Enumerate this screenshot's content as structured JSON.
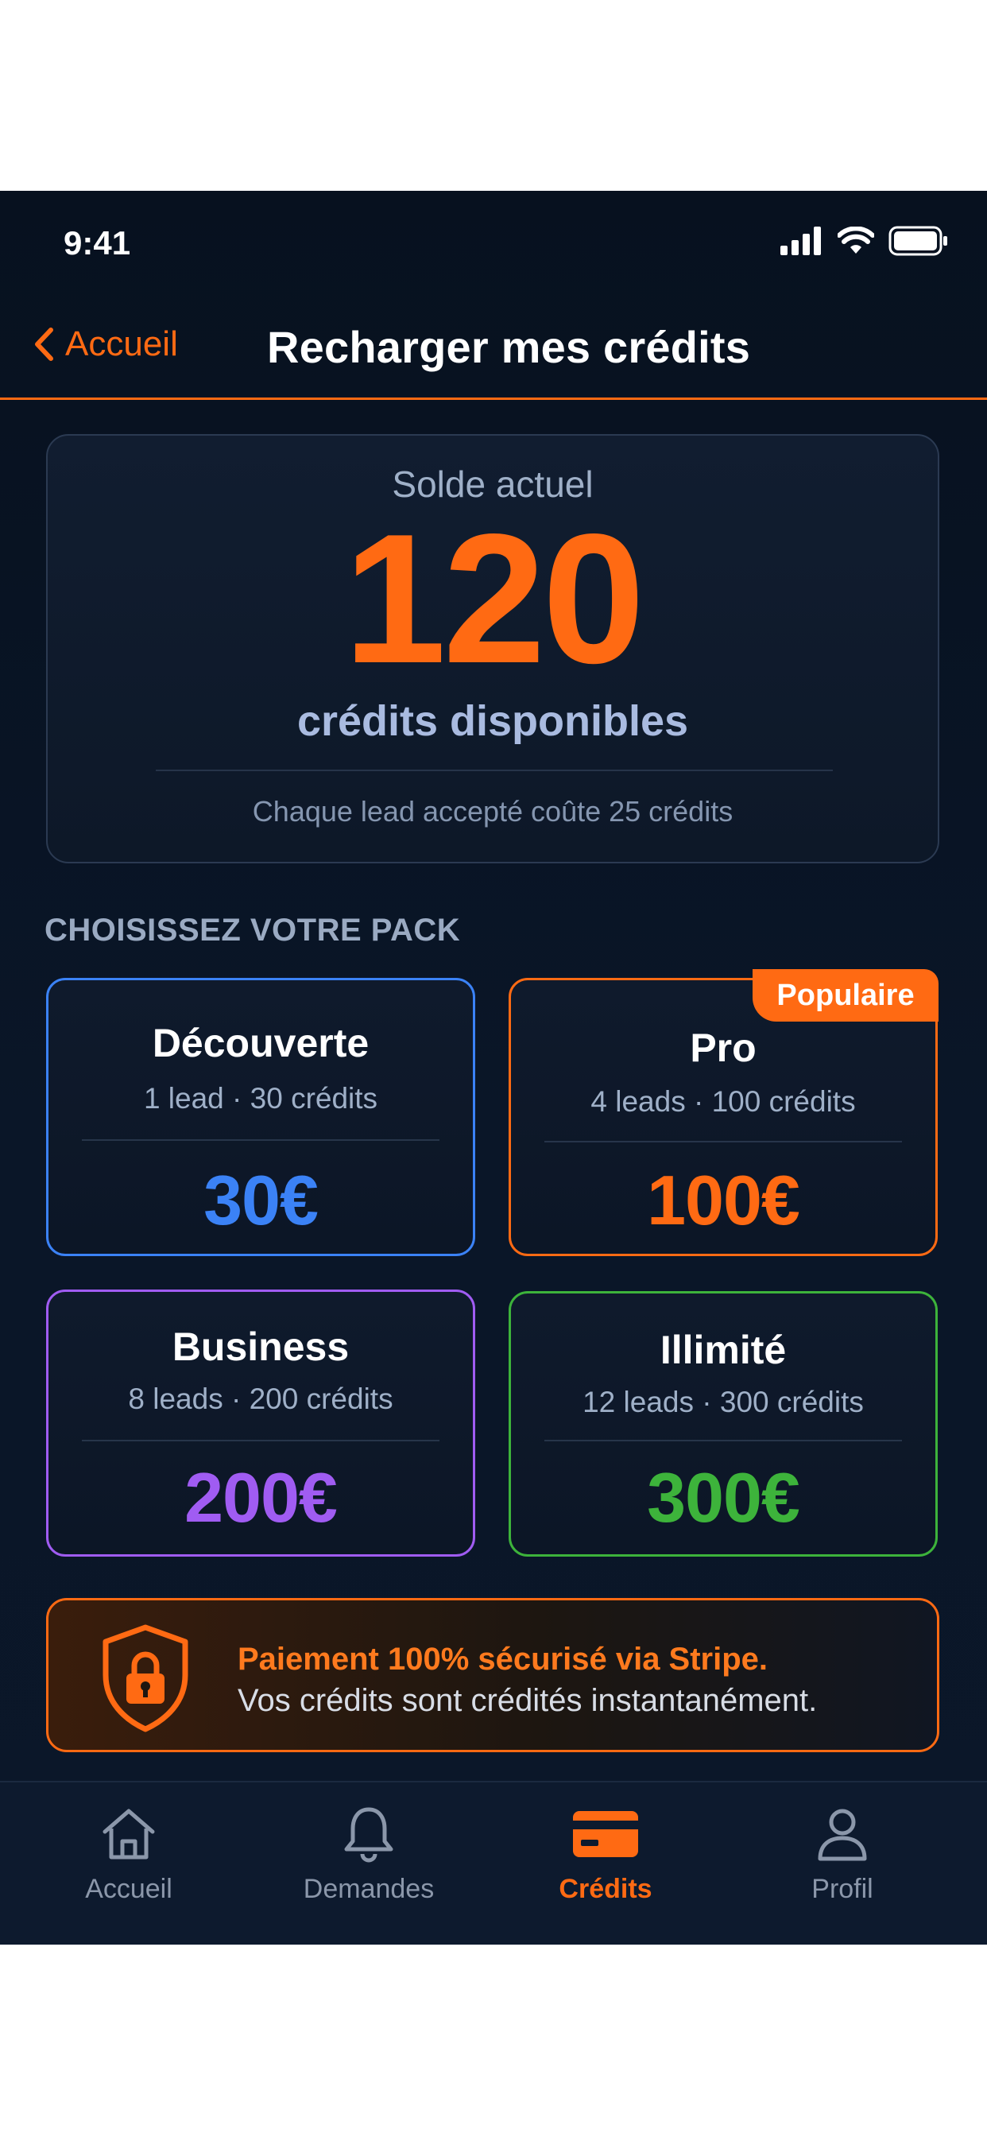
{
  "status_bar": {
    "time": "9:41",
    "icons": [
      "signal-icon",
      "wifi-icon",
      "battery-icon"
    ]
  },
  "nav": {
    "back_label": "Accueil",
    "title": "Recharger mes crédits"
  },
  "balance": {
    "label": "Solde actuel",
    "value": "120",
    "unit": "crédits disponibles",
    "note": "Chaque lead accepté coûte 25 crédits"
  },
  "packs_section": {
    "title": "CHOISISSEZ VOTRE PACK",
    "packs": [
      {
        "name": "Découverte",
        "detail": "1 lead · 30 crédits",
        "price": "30€",
        "color": "#3b82f6"
      },
      {
        "name": "Pro",
        "detail": "4 leads · 100 crédits",
        "price": "100€",
        "color": "#ff6a13",
        "badge": "Populaire"
      },
      {
        "name": "Business",
        "detail": "8 leads · 200 crédits",
        "price": "200€",
        "color": "#a05cf2"
      },
      {
        "name": "Illimité",
        "detail": "12 leads · 300 crédits",
        "price": "300€",
        "color": "#3db33b"
      }
    ]
  },
  "secure_banner": {
    "line1": "Paiement 100% sécurisé via Stripe.",
    "line2": "Vos crédits sont crédités instantanément.",
    "icon": "shield-lock-icon"
  },
  "tabbar": {
    "tabs": [
      {
        "label": "Accueil",
        "icon": "home-icon",
        "active": false
      },
      {
        "label": "Demandes",
        "icon": "bell-icon",
        "active": false
      },
      {
        "label": "Crédits",
        "icon": "credit-card-icon",
        "active": true
      },
      {
        "label": "Profil",
        "icon": "user-icon",
        "active": false
      }
    ]
  },
  "colors": {
    "accent": "#ff6a13",
    "background": "#07111f"
  }
}
